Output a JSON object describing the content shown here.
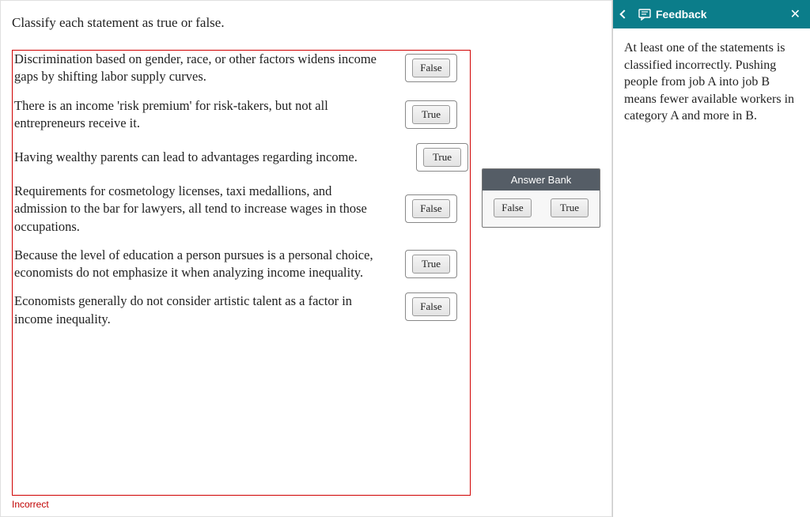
{
  "instruction": "Classify each statement as true or false.",
  "statements": [
    {
      "text": "Discrimination based on gender, race, or other factors widens income gaps by shifting labor supply curves.",
      "answer": "False"
    },
    {
      "text": "There is an income 'risk premium' for risk-takers, but not all entrepreneurs receive it.",
      "answer": "True"
    },
    {
      "text": "Having wealthy parents can lead to advantages regarding income.",
      "answer": "True"
    },
    {
      "text": "Requirements for cosmetology licenses, taxi medallions, and admission to the bar for lawyers, all tend to increase wages in those occupations.",
      "answer": "False"
    },
    {
      "text": "Because the level of education a person pursues is a personal choice, economists do not emphasize it when analyzing income inequality.",
      "answer": "True"
    },
    {
      "text": "Economists generally do not consider artistic talent as a factor in income inequality.",
      "answer": "False"
    }
  ],
  "answer_bank": {
    "header": "Answer Bank",
    "options": [
      "False",
      "True"
    ]
  },
  "status": "Incorrect",
  "feedback": {
    "title": "Feedback",
    "text": "At least one of the statements is classified incorrectly. Pushing people from job A into job B means fewer available workers in category A and more in B."
  }
}
